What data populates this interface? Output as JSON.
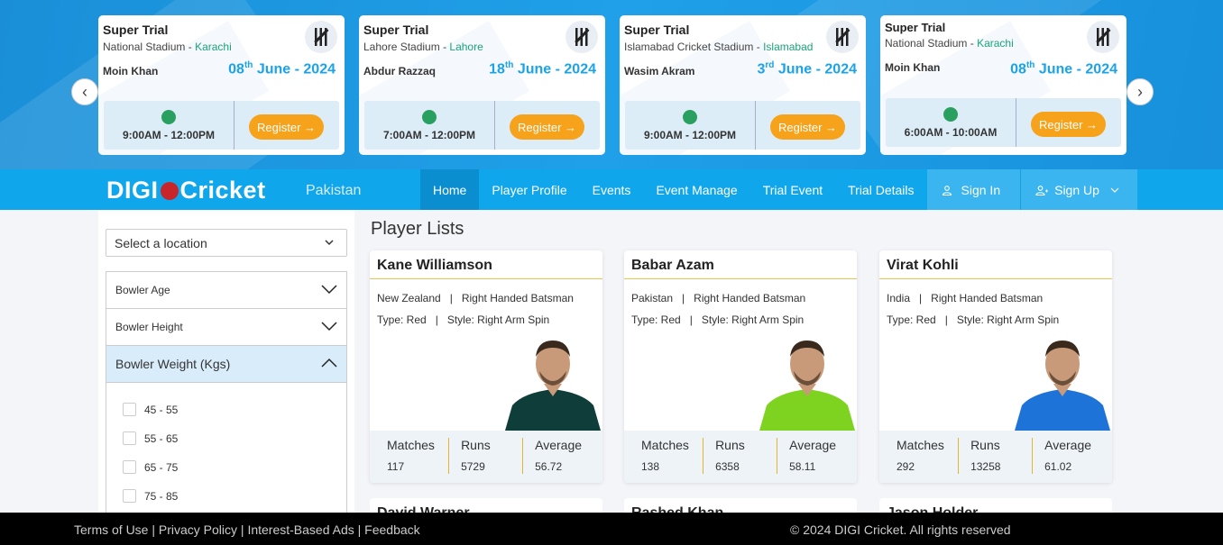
{
  "trials": [
    {
      "title": "Super Trial",
      "stadium": "National Stadium",
      "city": "Karachi",
      "coach": "Moin Khan",
      "day": "08",
      "suffix": "th",
      "month_year": "June - 2024",
      "time": "9:00AM - 12:00PM",
      "register": "Register →"
    },
    {
      "title": "Super Trial",
      "stadium": "Lahore Stadium",
      "city": "Lahore",
      "coach": "Abdur Razzaq",
      "day": "18",
      "suffix": "th",
      "month_year": "June - 2024",
      "time": "7:00AM - 12:00PM",
      "register": "Register →"
    },
    {
      "title": "Super Trial",
      "stadium": "Islamabad Cricket Stadium",
      "city": "Islamabad",
      "coach": "Wasim Akram",
      "day": "3",
      "suffix": "rd",
      "month_year": "June - 2024",
      "time": "9:00AM - 12:00PM",
      "register": "Register →"
    },
    {
      "title": "Super Trial",
      "stadium": "National Stadium",
      "city": "Karachi",
      "coach": "Moin Khan",
      "day": "08",
      "suffix": "th",
      "month_year": "June - 2024",
      "time": "6:00AM - 10:00AM",
      "register": "Register →"
    }
  ],
  "venue_sep": " - ",
  "carousel": {
    "prev": "‹",
    "next": "›"
  },
  "brand": {
    "left": "DIGI",
    "right": "Cricket",
    "country": "Pakistan"
  },
  "nav": {
    "home": "Home",
    "player_profile": "Player Profile",
    "events": "Events",
    "event_manage": "Event Manage",
    "trial_event": "Trial Event",
    "trial_details": "Trial Details",
    "sign_in": "Sign In",
    "sign_up": "Sign Up"
  },
  "filters": {
    "location_placeholder": "Select a location",
    "bowler_age": "Bowler Age",
    "bowler_height": "Bowler Height",
    "bowler_weight": "Bowler Weight (Kgs)",
    "weight_options": [
      "45 - 55",
      "55 - 65",
      "65 - 75",
      "75 - 85"
    ]
  },
  "player_list_title": "Player Lists",
  "players": [
    {
      "name": "Kane Williamson",
      "country": "New Zealand",
      "role": "Right Handed Batsman",
      "type": "Type: Red",
      "style": "Style: Right Arm Spin",
      "matches": "117",
      "runs": "5729",
      "average": "56.72",
      "jersey": "#0e3d3a"
    },
    {
      "name": "Babar Azam",
      "country": "Pakistan",
      "role": "Right Handed Batsman",
      "type": "Type: Red",
      "style": "Style: Right Arm Spin",
      "matches": "138",
      "runs": "6358",
      "average": "58.11",
      "jersey": "#7ed321"
    },
    {
      "name": "Virat Kohli",
      "country": "India",
      "role": "Right Handed Batsman",
      "type": "Type: Red",
      "style": "Style: Right Arm Spin",
      "matches": "292",
      "runs": "13258",
      "average": "61.02",
      "jersey": "#1e73d8"
    }
  ],
  "stat_labels": {
    "matches": "Matches",
    "runs": "Runs",
    "average": "Average"
  },
  "more_players": [
    "David Warner",
    "Rashed Khan",
    "Jason Holder"
  ],
  "footer": {
    "terms": "Terms of Use",
    "privacy": "Privacy Policy",
    "ads": "Interest-Based Ads",
    "feedback": "Feedback",
    "sep": " | ",
    "copyright": "© 2024 DIGI Cricket. All rights reserved"
  }
}
